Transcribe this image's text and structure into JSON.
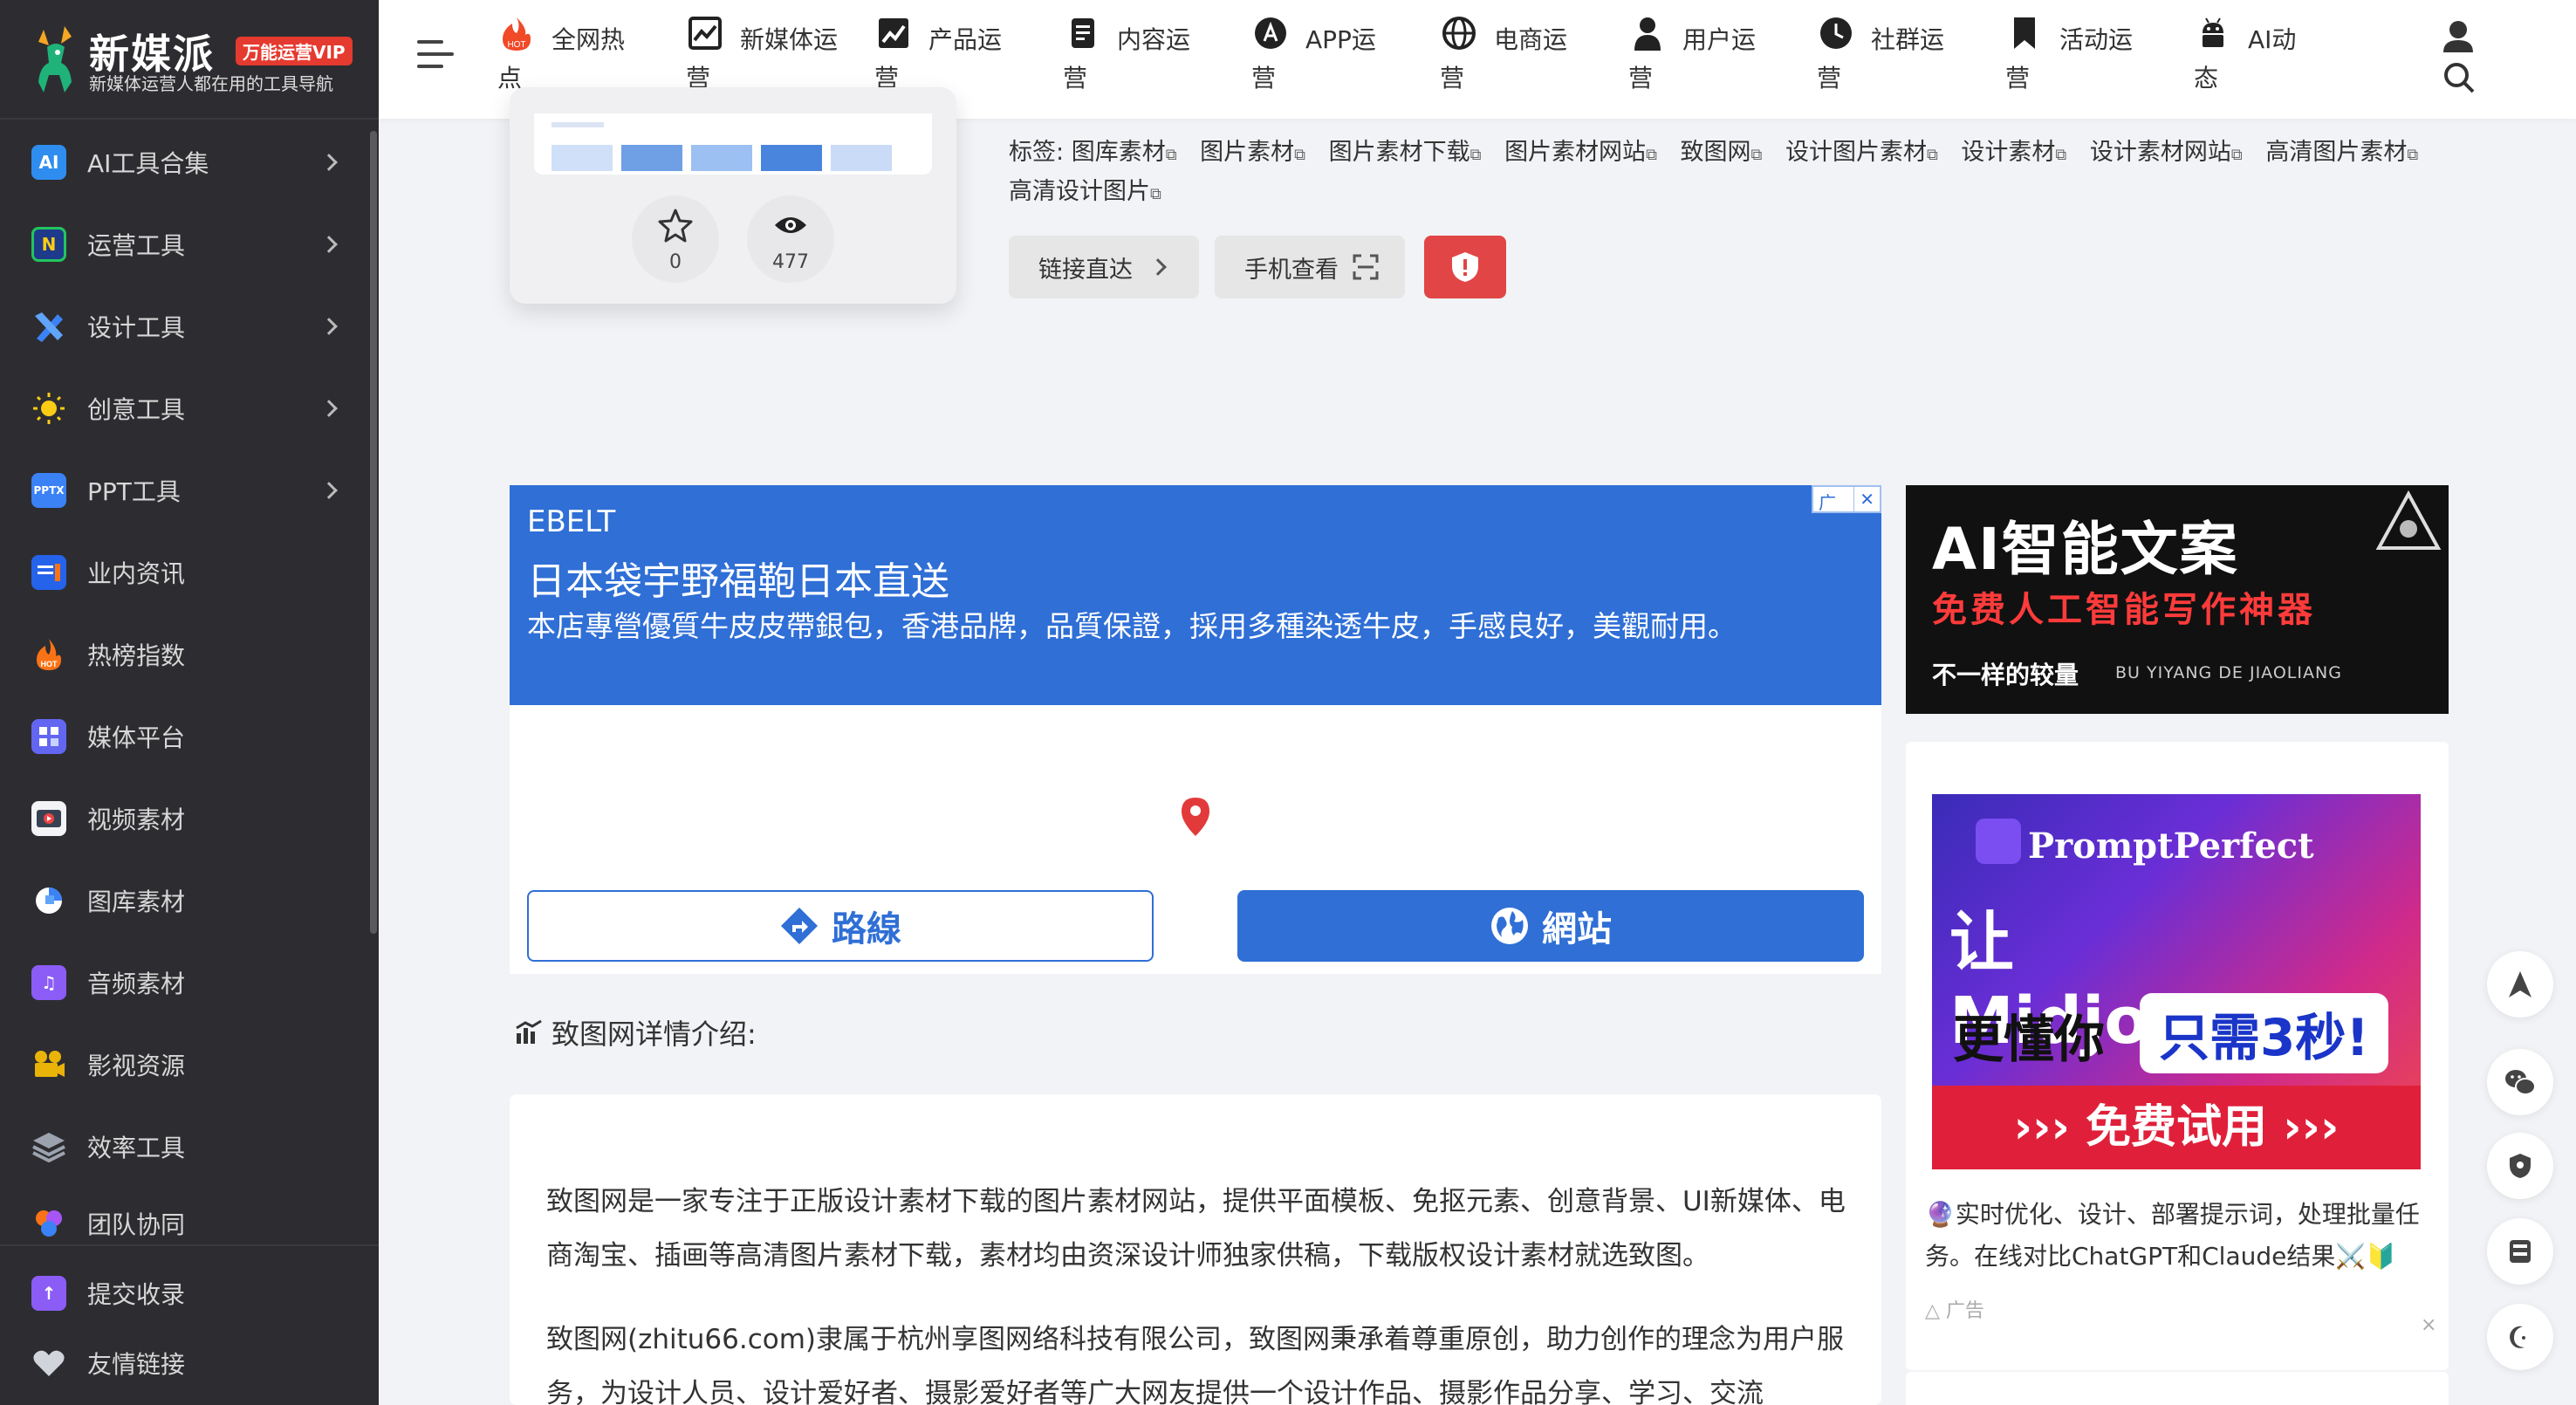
{
  "brand": {
    "name": "新媒派",
    "vip_badge": "万能运营VIP",
    "slogan": "新媒体运营人都在用的工具导航"
  },
  "sidebar": {
    "items": [
      {
        "label": "AI工具合集",
        "icon": "ai-icon",
        "has_arrow": true
      },
      {
        "label": "运营工具",
        "icon": "ops-icon",
        "has_arrow": true
      },
      {
        "label": "设计工具",
        "icon": "design-icon",
        "has_arrow": true
      },
      {
        "label": "创意工具",
        "icon": "bulb-icon",
        "has_arrow": true
      },
      {
        "label": "PPT工具",
        "icon": "ppt-icon",
        "has_arrow": true
      },
      {
        "label": "业内资讯",
        "icon": "news-icon",
        "has_arrow": false
      },
      {
        "label": "热榜指数",
        "icon": "hot-icon",
        "has_arrow": false
      },
      {
        "label": "媒体平台",
        "icon": "media-icon",
        "has_arrow": false
      },
      {
        "label": "视频素材",
        "icon": "video-icon",
        "has_arrow": false
      },
      {
        "label": "图库素材",
        "icon": "gallery-icon",
        "has_arrow": false
      },
      {
        "label": "音频素材",
        "icon": "audio-icon",
        "has_arrow": false
      },
      {
        "label": "影视资源",
        "icon": "film-icon",
        "has_arrow": false
      },
      {
        "label": "效率工具",
        "icon": "layers-icon",
        "has_arrow": false
      },
      {
        "label": "团队协同",
        "icon": "team-icon",
        "has_arrow": false
      }
    ],
    "bottom_items": [
      {
        "label": "提交收录",
        "icon": "submit-icon"
      },
      {
        "label": "友情链接",
        "icon": "heart-icon"
      }
    ]
  },
  "topnav": {
    "items": [
      {
        "l1": "全网热",
        "l2": "点",
        "icon": "hot-fire-icon"
      },
      {
        "l1": "新媒体运",
        "l2": "营",
        "icon": "trend-icon"
      },
      {
        "l1": "产品运",
        "l2": "营",
        "icon": "chart-up-icon"
      },
      {
        "l1": "内容运",
        "l2": "营",
        "icon": "doc-icon"
      },
      {
        "l1": "APP运",
        "l2": "营",
        "icon": "appstore-icon"
      },
      {
        "l1": "电商运",
        "l2": "营",
        "icon": "globe-icon"
      },
      {
        "l1": "用户运",
        "l2": "营",
        "icon": "user-icon"
      },
      {
        "l1": "社群运",
        "l2": "营",
        "icon": "clock-icon"
      },
      {
        "l1": "活动运",
        "l2": "营",
        "icon": "bookmark-icon"
      },
      {
        "l1": "AI动",
        "l2": "态",
        "icon": "android-icon"
      }
    ],
    "hot_badge": "HOT"
  },
  "detail": {
    "stars": "0",
    "views": "477",
    "tags_label": "标签:",
    "tags": [
      "图库素材",
      "图片素材",
      "图片素材下载",
      "图片素材网站",
      "致图网",
      "设计图片素材",
      "设计素材",
      "设计素材网站",
      "高清图片素材",
      "高清设计图片"
    ],
    "btn_direct": "链接直达",
    "btn_mobile": "手机查看"
  },
  "ad_main": {
    "brand": "EBELT",
    "title": "日本袋宇野福鞄日本直送",
    "desc": "本店專營優質牛皮皮帶銀包，香港品牌，品質保證，採用多種染透牛皮，手感良好，美觀耐用。",
    "corner": "广告",
    "route": "路線",
    "site": "網站"
  },
  "intro": {
    "heading": "致图网详情介绍:",
    "p1": "致图网是一家专注于正版设计素材下载的图片素材网站，提供平面模板、免抠元素、创意背景、UI新媒体、电商淘宝、插画等高清图片素材下载，素材均由资深设计师独家供稿，下载版权设计素材就选致图。",
    "p2": "致图网(zhitu66.com)隶属于杭州享图网络科技有限公司，致图网秉承着尊重原创，助力创作的理念为用户服务，为设计人员、设计爱好者、摄影爱好者等广大网友提供一个设计作品、摄影作品分享、学习、交流"
  },
  "ad_right1": {
    "title": "AI智能文案",
    "sub": "免费人工智能写作神器",
    "tag": "不一样的较量",
    "pinyin": "BU YIYANG DE JIAOLIANG"
  },
  "ad_right2": {
    "brand": "PromptPerfect",
    "headline": "让Midjourney",
    "line2a": "更懂你",
    "line2b": "只需3秒!",
    "cta": "››› 免费试用 ›››",
    "desc": "🔮实时优化、设计、部署提示词，处理批量任务。在线对比ChatGPT和Claude结果⚔️🔰",
    "ad_label": "广告",
    "close": "×"
  },
  "float_tools": [
    "top-arrow-icon",
    "wechat-icon",
    "shield-icon",
    "calculator-icon",
    "moon-icon"
  ],
  "colors": {
    "sidebar_bg": "#2d2d31",
    "accent_blue": "#2f6fd6",
    "danger_red": "#e24545"
  }
}
